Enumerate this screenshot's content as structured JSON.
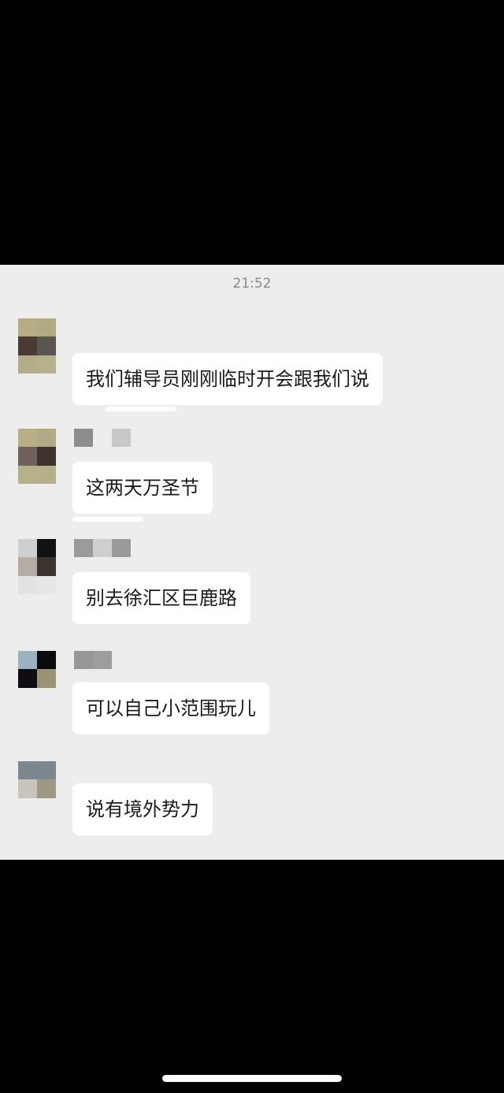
{
  "chat": {
    "timestamp": "21:52",
    "messages": [
      {
        "text": "我们辅导员刚刚临时开会跟我们说"
      },
      {
        "text": "这两天万圣节"
      },
      {
        "text": "别去徐汇区巨鹿路"
      },
      {
        "text": "可以自己小范围玩儿"
      },
      {
        "text": "说有境外势力"
      }
    ]
  },
  "colors": {
    "panel_background": "#ededed",
    "bubble_background": "#ffffff",
    "screen_background": "#000000",
    "timestamp_text": "#8a8a8a",
    "message_text": "#1a1a1a"
  },
  "icons": {
    "avatar": "pixelated-avatar-icon",
    "sender_name": "pixelated-name"
  }
}
